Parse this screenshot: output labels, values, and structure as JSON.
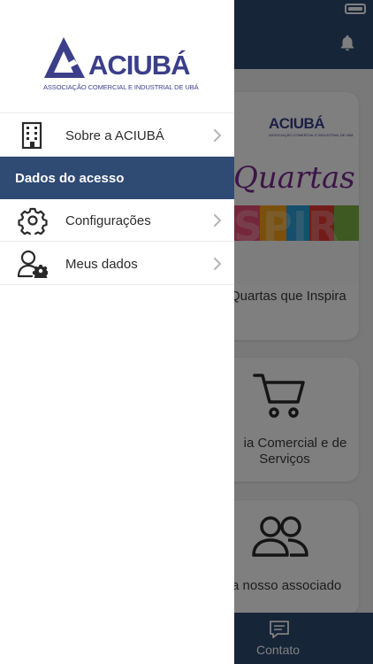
{
  "drawer": {
    "logo": {
      "name": "ACIUBÁ",
      "tagline": "ASSOCIAÇÃO COMERCIAL E INDUSTRIAL DE UBÁ"
    },
    "items": [
      {
        "label": "Sobre a ACIUBÁ",
        "icon": "building-icon"
      }
    ],
    "section_header": "Dados do acesso",
    "section_items": [
      {
        "label": "Configurações",
        "icon": "gear-icon"
      },
      {
        "label": "Meus dados",
        "icon": "user-gear-icon"
      }
    ]
  },
  "background": {
    "cards": [
      {
        "logo": "ACIUBÁ",
        "logo_sub": "ASSOCIAÇÃO COMERCIAL E INDUSTRIAL DE UBÁ",
        "caption": "Quartas que Inspira"
      },
      {
        "line1": "ia Comercial e de",
        "line2": "Serviços",
        "icon": "cart-icon"
      },
      {
        "caption": "a nosso associado",
        "icon": "people-icon"
      }
    ],
    "bottom_nav": {
      "label": "Contato",
      "icon": "message-icon"
    }
  },
  "colors": {
    "primary": "#2f4a73",
    "brand": "#3b3f8a",
    "overlay": "rgba(0,0,0,0.5)"
  }
}
